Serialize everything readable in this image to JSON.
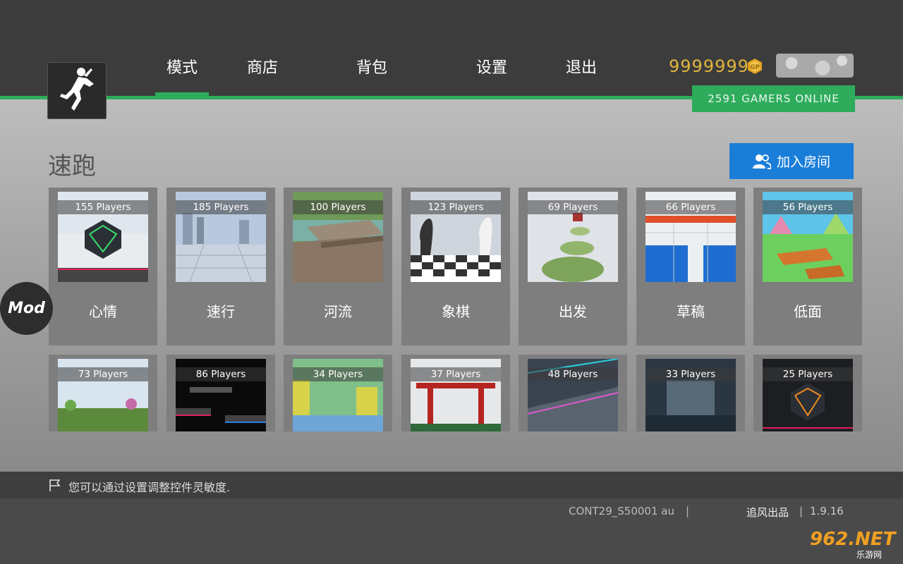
{
  "nav": {
    "tabs": [
      {
        "label": "模式",
        "active": true
      },
      {
        "label": "商店"
      },
      {
        "label": "背包"
      },
      {
        "label": "设置"
      },
      {
        "label": "退出"
      }
    ]
  },
  "header": {
    "coins": "9999999",
    "online": "2591 GAMERS ONLINE",
    "coin_icon": "gold-coin-icon",
    "accent_color": "#2eac5c"
  },
  "main": {
    "title": "速跑",
    "join_room_label": "加入房间"
  },
  "maps_row1": [
    {
      "players": "155 Players",
      "name": "心情"
    },
    {
      "players": "185 Players",
      "name": "速行"
    },
    {
      "players": "100 Players",
      "name": "河流"
    },
    {
      "players": "123 Players",
      "name": "象棋"
    },
    {
      "players": "69 Players",
      "name": "出发"
    },
    {
      "players": "66 Players",
      "name": "草稿"
    },
    {
      "players": "56 Players",
      "name": "低面"
    }
  ],
  "maps_row2": [
    {
      "players": "73 Players"
    },
    {
      "players": "86 Players"
    },
    {
      "players": "34 Players"
    },
    {
      "players": "37 Players"
    },
    {
      "players": "48 Players"
    },
    {
      "players": "33 Players"
    },
    {
      "players": "25 Players"
    }
  ],
  "mod_badge": "Mod",
  "tip": "您可以通过设置调整控件灵敏度.",
  "footer": {
    "build": "CONT29_S50001 au",
    "separator": "|",
    "publisher": "追风出品",
    "version": "1.9.16"
  },
  "watermark": {
    "text": "962.NET",
    "sub": "乐游网"
  }
}
